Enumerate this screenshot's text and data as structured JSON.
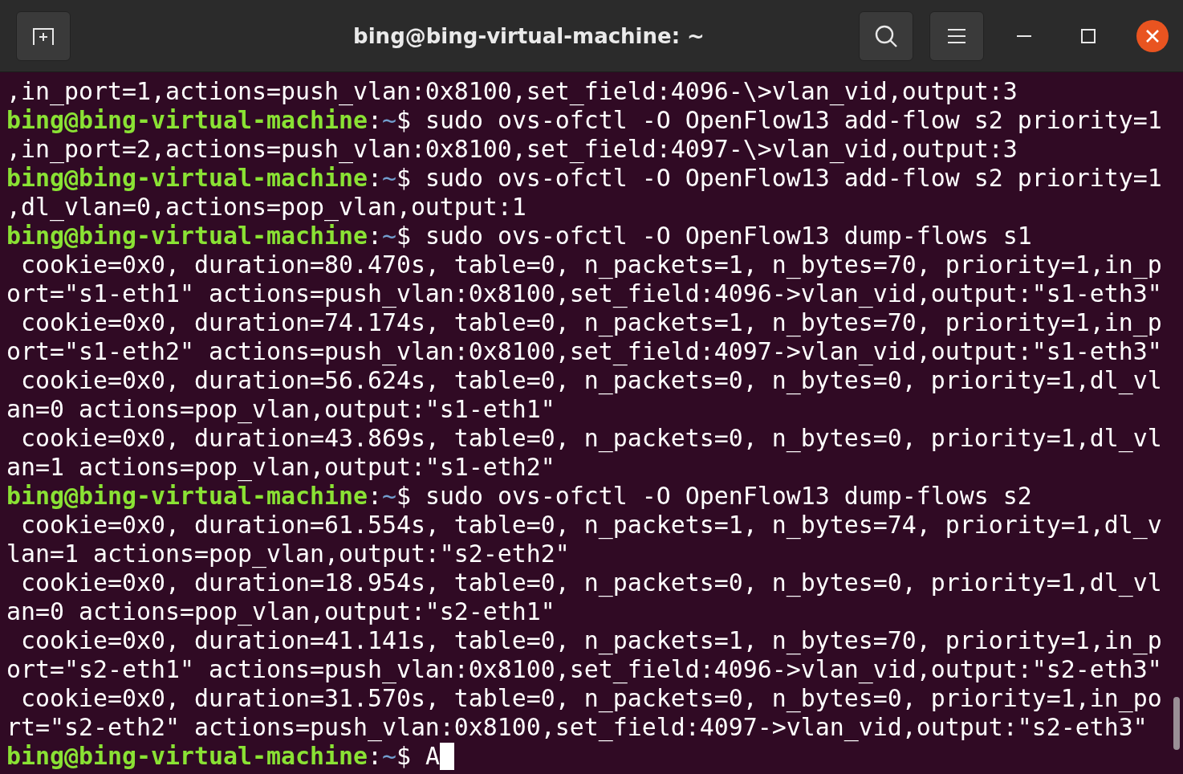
{
  "window": {
    "title": "bing@bing-virtual-machine: ~"
  },
  "terminal": {
    "lines": [
      {
        "kind": "output",
        "text": ",in_port=1,actions=push_vlan:0x8100,set_field:4096-\\>vlan_vid,output:3"
      },
      {
        "kind": "prompt",
        "host": "bing@bing-virtual-machine",
        "sep": ":",
        "path": "~",
        "sign": "$",
        "command": "sudo ovs-ofctl -O OpenFlow13 add-flow s2 priority=1"
      },
      {
        "kind": "output",
        "text": ",in_port=2,actions=push_vlan:0x8100,set_field:4097-\\>vlan_vid,output:3"
      },
      {
        "kind": "prompt",
        "host": "bing@bing-virtual-machine",
        "sep": ":",
        "path": "~",
        "sign": "$",
        "command": "sudo ovs-ofctl -O OpenFlow13 add-flow s2 priority=1"
      },
      {
        "kind": "output",
        "text": ",dl_vlan=0,actions=pop_vlan,output:1"
      },
      {
        "kind": "prompt",
        "host": "bing@bing-virtual-machine",
        "sep": ":",
        "path": "~",
        "sign": "$",
        "command": "sudo ovs-ofctl -O OpenFlow13 dump-flows s1"
      },
      {
        "kind": "output",
        "text": " cookie=0x0, duration=80.470s, table=0, n_packets=1, n_bytes=70, priority=1,in_p"
      },
      {
        "kind": "output",
        "text": "ort=\"s1-eth1\" actions=push_vlan:0x8100,set_field:4096->vlan_vid,output:\"s1-eth3\""
      },
      {
        "kind": "output",
        "text": " cookie=0x0, duration=74.174s, table=0, n_packets=1, n_bytes=70, priority=1,in_p"
      },
      {
        "kind": "output",
        "text": "ort=\"s1-eth2\" actions=push_vlan:0x8100,set_field:4097->vlan_vid,output:\"s1-eth3\""
      },
      {
        "kind": "output",
        "text": " cookie=0x0, duration=56.624s, table=0, n_packets=0, n_bytes=0, priority=1,dl_vl"
      },
      {
        "kind": "output",
        "text": "an=0 actions=pop_vlan,output:\"s1-eth1\""
      },
      {
        "kind": "output",
        "text": " cookie=0x0, duration=43.869s, table=0, n_packets=0, n_bytes=0, priority=1,dl_vl"
      },
      {
        "kind": "output",
        "text": "an=1 actions=pop_vlan,output:\"s1-eth2\""
      },
      {
        "kind": "prompt",
        "host": "bing@bing-virtual-machine",
        "sep": ":",
        "path": "~",
        "sign": "$",
        "command": "sudo ovs-ofctl -O OpenFlow13 dump-flows s2"
      },
      {
        "kind": "output",
        "text": " cookie=0x0, duration=61.554s, table=0, n_packets=1, n_bytes=74, priority=1,dl_v"
      },
      {
        "kind": "output",
        "text": "lan=1 actions=pop_vlan,output:\"s2-eth2\""
      },
      {
        "kind": "output",
        "text": " cookie=0x0, duration=18.954s, table=0, n_packets=0, n_bytes=0, priority=1,dl_vl"
      },
      {
        "kind": "output",
        "text": "an=0 actions=pop_vlan,output:\"s2-eth1\""
      },
      {
        "kind": "output",
        "text": " cookie=0x0, duration=41.141s, table=0, n_packets=1, n_bytes=70, priority=1,in_p"
      },
      {
        "kind": "output",
        "text": "ort=\"s2-eth1\" actions=push_vlan:0x8100,set_field:4096->vlan_vid,output:\"s2-eth3\""
      },
      {
        "kind": "output",
        "text": " cookie=0x0, duration=31.570s, table=0, n_packets=0, n_bytes=0, priority=1,in_po"
      },
      {
        "kind": "output",
        "text": "rt=\"s2-eth2\" actions=push_vlan:0x8100,set_field:4097->vlan_vid,output:\"s2-eth3\""
      },
      {
        "kind": "prompt",
        "host": "bing@bing-virtual-machine",
        "sep": ":",
        "path": "~",
        "sign": "$",
        "command": "A",
        "cursor": true
      }
    ]
  }
}
